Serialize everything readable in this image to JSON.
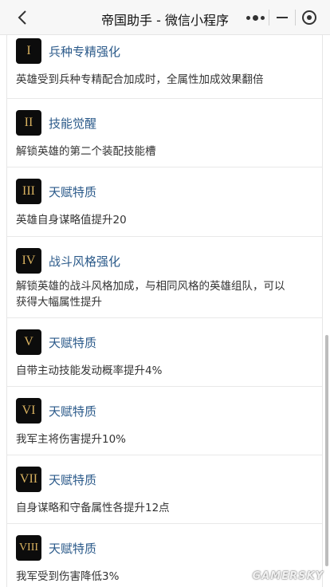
{
  "topbar": {
    "title": "帝国助手 - 微信小程序"
  },
  "items": [
    {
      "numeral": "I",
      "title": "兵种专精强化",
      "desc": "英雄受到兵种专精配合加成时，全属性加成效果翻倍"
    },
    {
      "numeral": "II",
      "title": "技能觉醒",
      "desc": "解锁英雄的第二个装配技能槽"
    },
    {
      "numeral": "III",
      "title": "天赋特质",
      "desc": "英雄自身谋略值提升20"
    },
    {
      "numeral": "IV",
      "title": "战斗风格强化",
      "desc": "解锁英雄的战斗风格加成，与相同风格的英雄组队，可以获得大幅属性提升"
    },
    {
      "numeral": "V",
      "title": "天赋特质",
      "desc": "自带主动技能发动概率提升4%"
    },
    {
      "numeral": "VI",
      "title": "天赋特质",
      "desc": "我军主将伤害提升10%"
    },
    {
      "numeral": "VII",
      "title": "天赋特质",
      "desc": "自身谋略和守备属性各提升12点"
    },
    {
      "numeral": "VIII",
      "title": "天赋特质",
      "desc": "我军受到伤害降低3%"
    }
  ],
  "watermark": "GAMERSKY",
  "colors": {
    "badge_bg": "#0c0c0c",
    "numeral": "#d9b25f",
    "title_link": "#2b5a8a"
  }
}
